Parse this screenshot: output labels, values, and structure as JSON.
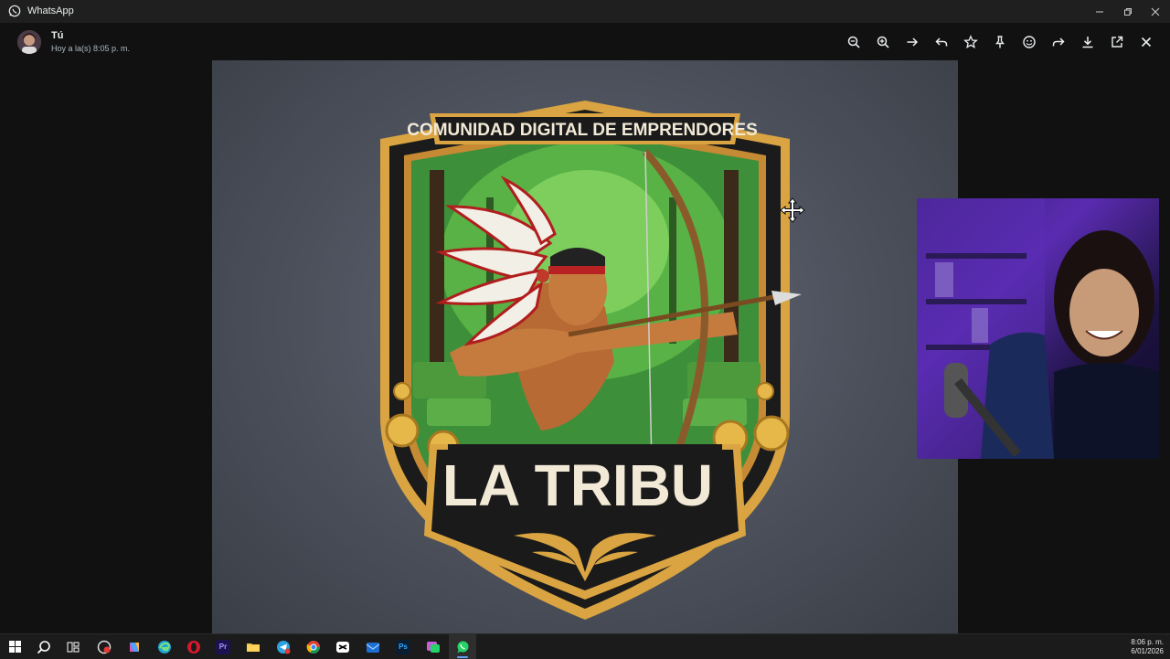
{
  "window": {
    "title": "WhatsApp"
  },
  "viewer": {
    "sender": "Tú",
    "sent_time": "Hoy a la(s) 8:05 p. m.",
    "toolbar": [
      {
        "name": "zoom-out-icon"
      },
      {
        "name": "zoom-in-icon"
      },
      {
        "name": "arrow-right-icon"
      },
      {
        "name": "reply-icon"
      },
      {
        "name": "star-icon"
      },
      {
        "name": "pin-icon"
      },
      {
        "name": "emoji-icon"
      },
      {
        "name": "forward-icon"
      },
      {
        "name": "download-icon"
      },
      {
        "name": "open-external-icon"
      },
      {
        "name": "close-icon"
      }
    ]
  },
  "image": {
    "banner_text": "COMUNIDAD DIGITAL DE EMPRENDORES",
    "title_text": "LA TRIBU"
  },
  "taskbar": {
    "apps": [
      {
        "name": "start-icon"
      },
      {
        "name": "search-icon"
      },
      {
        "name": "task-view-icon"
      },
      {
        "name": "app-icon-1"
      },
      {
        "name": "copilot-icon"
      },
      {
        "name": "edge-icon"
      },
      {
        "name": "opera-icon"
      },
      {
        "name": "premiere-icon",
        "label": "Pr"
      },
      {
        "name": "file-explorer-icon"
      },
      {
        "name": "telegram-icon"
      },
      {
        "name": "chrome-icon"
      },
      {
        "name": "capcut-icon"
      },
      {
        "name": "outlook-icon"
      },
      {
        "name": "photoshop-icon",
        "label": "Ps"
      },
      {
        "name": "whatsapp-business-icon"
      },
      {
        "name": "whatsapp-icon"
      }
    ],
    "time": "8:06 p. m.",
    "date": "6/01/2026"
  },
  "colors": {
    "accent": "#5ea0ef",
    "banner_bg": "#1a1a1a",
    "gold": "#d9a441",
    "forest": "#3e8f3a"
  }
}
